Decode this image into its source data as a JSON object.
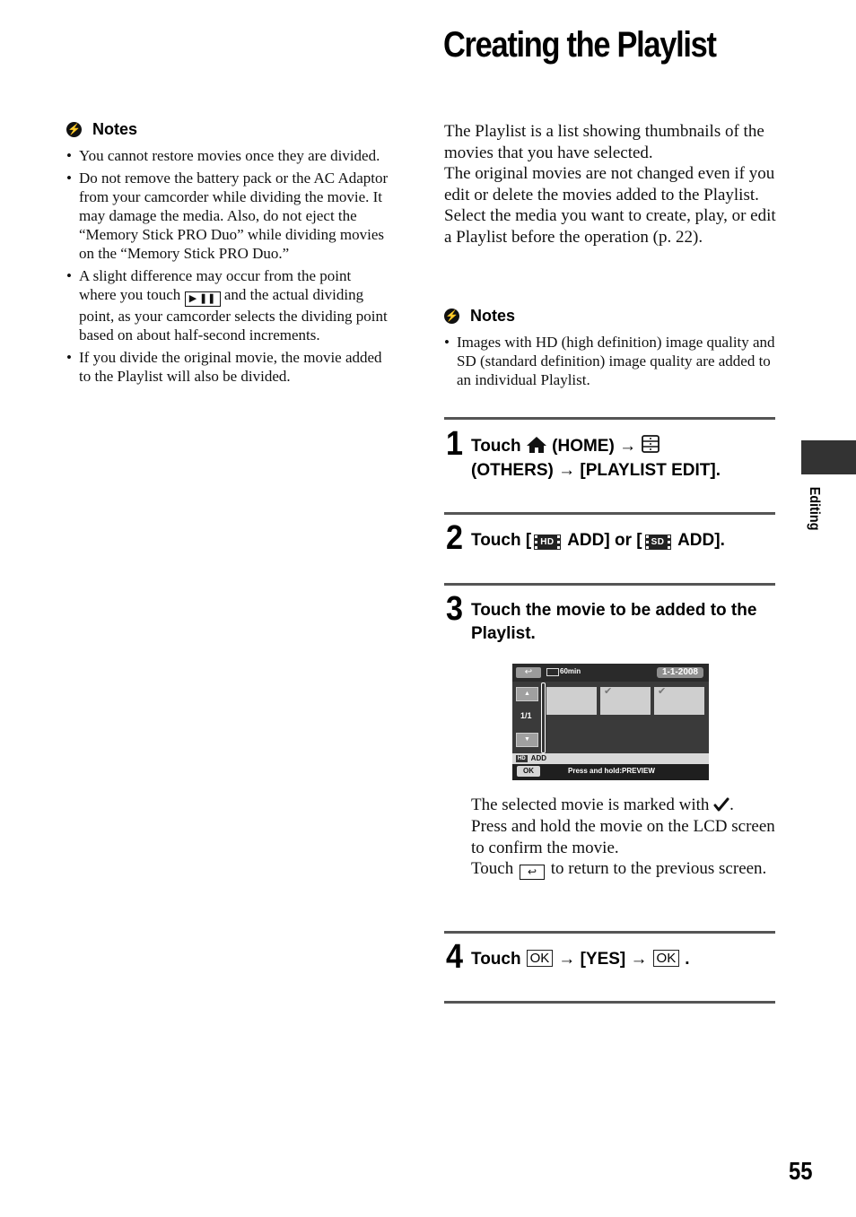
{
  "page": {
    "title": "Creating the Playlist",
    "section_tab": "Editing",
    "page_number": "55"
  },
  "left_notes": {
    "heading": "Notes",
    "items": [
      {
        "text": "You cannot restore movies once they are divided."
      },
      {
        "text": "Do not remove the battery pack or the AC Adaptor from your camcorder while dividing the movie. It may damage the media. Also, do not eject the “Memory Stick PRO Duo” while dividing movies on the “Memory Stick PRO Duo.”"
      },
      {
        "before": "A slight difference may occur from the point where you touch",
        "icon": "play-pause-icon",
        "after": "and the actual dividing point, as your camcorder selects the dividing point based on about half-second increments."
      },
      {
        "text": "If you divide the original movie, the movie added to the Playlist will also be divided."
      }
    ]
  },
  "intro": {
    "paragraphs": [
      "The Playlist is a list showing thumbnails of the movies that you have selected.",
      "The original movies are not changed even if you edit or delete the movies added to the Playlist.",
      "Select the media you want to create, play, or edit a Playlist before the operation (p. 22)."
    ]
  },
  "right_notes": {
    "heading": "Notes",
    "items": [
      {
        "text": "Images with HD (high definition) image quality and SD (standard definition) image quality are added to an individual Playlist."
      }
    ]
  },
  "steps": [
    {
      "number": "1",
      "touch": "Touch",
      "home_label": "(HOME)",
      "arrow": "→",
      "others_label": "(OTHERS)",
      "target": "[PLAYLIST EDIT]."
    },
    {
      "number": "2",
      "touch": "Touch [",
      "hd_badge": "HD",
      "hd_add": " ADD] or [",
      "sd_badge": "SD",
      "sd_add": " ADD]."
    },
    {
      "number": "3",
      "text": "Touch the movie to be added to the Playlist.",
      "description": {
        "line1_before": "The selected movie is marked with",
        "line1_after": ".",
        "line2": "Press and hold the movie on the LCD screen to confirm the movie.",
        "line3_before": "Touch",
        "line3_after": "to return to the previous screen."
      }
    },
    {
      "number": "4",
      "touch": "Touch",
      "ok1": "OK",
      "arrow": "→",
      "yes": "[YES]",
      "ok2": "OK",
      "end": "."
    }
  ],
  "lcd_screen": {
    "back_icon": "↩",
    "battery_remaining": "60min",
    "date": "1-1-2008",
    "page_indicator": "1/1",
    "up_icon": "▲",
    "down_icon": "▼",
    "thumbnails": [
      {
        "selected": false
      },
      {
        "selected": true
      },
      {
        "selected": true
      }
    ],
    "check_mark": "✔",
    "mode_badge": "HD",
    "mode_label": "ADD",
    "ok_button": "OK",
    "hint": "Press and hold:PREVIEW"
  }
}
